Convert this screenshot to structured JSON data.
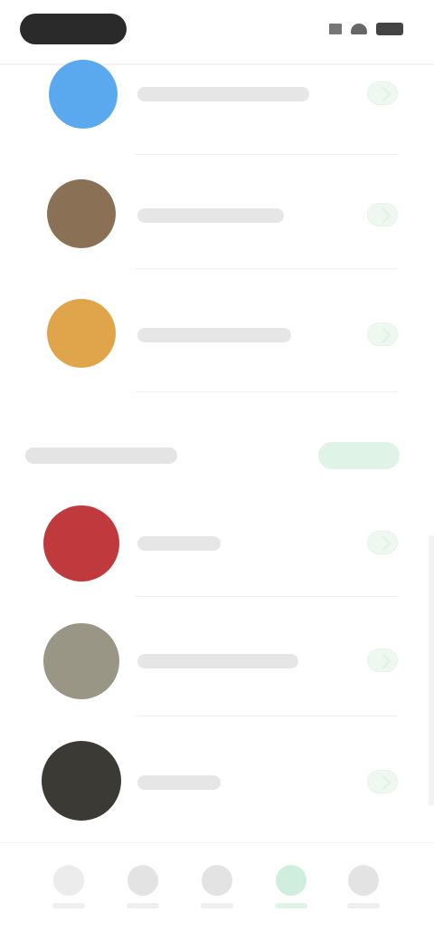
{
  "section": {
    "title": "",
    "see_all_label": ""
  },
  "items_top": [
    {
      "name": "",
      "avatar_color": "#5aa9ee"
    },
    {
      "name": "",
      "avatar_color": "#8a7156"
    },
    {
      "name": "",
      "avatar_color": "#e0a54a"
    }
  ],
  "items_bottom": [
    {
      "name": "",
      "avatar_color": "#c03a3d"
    },
    {
      "name": "",
      "avatar_color": "#9a9686"
    },
    {
      "name": "",
      "avatar_color": "#3b3a34"
    }
  ],
  "bottom_nav": [
    {
      "label": "",
      "icon": "home-icon"
    },
    {
      "label": "",
      "icon": "search-icon"
    },
    {
      "label": "",
      "icon": "library-icon"
    },
    {
      "label": "",
      "icon": "people-icon",
      "active": true
    },
    {
      "label": "",
      "icon": "profile-icon"
    }
  ],
  "colors": {
    "accent": "#2fbf6f",
    "accent_soft": "#dff3e6"
  }
}
